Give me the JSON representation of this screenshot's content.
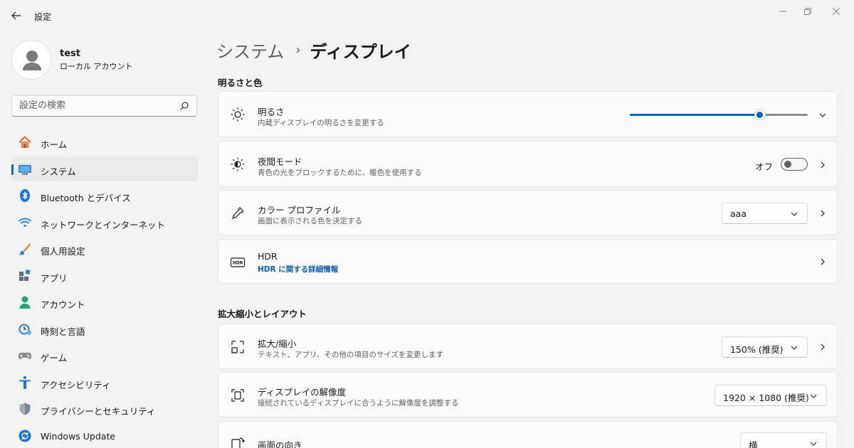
{
  "window": {
    "title": "設定"
  },
  "profile": {
    "name": "test",
    "type": "ローカル アカウント"
  },
  "search": {
    "placeholder": "設定の検索"
  },
  "sidebar": {
    "items": [
      {
        "label": "ホーム",
        "icon": "home-icon"
      },
      {
        "label": "システム",
        "icon": "system-icon",
        "active": true
      },
      {
        "label": "Bluetooth とデバイス",
        "icon": "bluetooth-icon"
      },
      {
        "label": "ネットワークとインターネット",
        "icon": "wifi-icon"
      },
      {
        "label": "個人用設定",
        "icon": "brush-icon"
      },
      {
        "label": "アプリ",
        "icon": "apps-icon"
      },
      {
        "label": "アカウント",
        "icon": "account-icon"
      },
      {
        "label": "時刻と言語",
        "icon": "clock-globe-icon"
      },
      {
        "label": "ゲーム",
        "icon": "gamepad-icon"
      },
      {
        "label": "アクセシビリティ",
        "icon": "accessibility-icon"
      },
      {
        "label": "プライバシーとセキュリティ",
        "icon": "shield-icon"
      },
      {
        "label": "Windows Update",
        "icon": "update-icon"
      }
    ]
  },
  "breadcrumb": {
    "parent": "システム",
    "separator": "›",
    "current": "ディスプレイ"
  },
  "sections": {
    "brightness_color": {
      "title": "明るさと色",
      "brightness": {
        "title": "明るさ",
        "desc": "内蔵ディスプレイの明るさを変更する",
        "value": 0.73
      },
      "night_light": {
        "title": "夜間モード",
        "desc": "青色の光をブロックするために、暖色を使用する",
        "state": "オフ"
      },
      "color_profile": {
        "title": "カラー プロファイル",
        "desc": "画面に表示される色を決定する",
        "value": "aaa"
      },
      "hdr": {
        "title": "HDR",
        "link": "HDR に関する詳細情報"
      }
    },
    "scale_layout": {
      "title": "拡大縮小とレイアウト",
      "scale": {
        "title": "拡大/縮小",
        "desc": "テキスト、アプリ、その他の項目のサイズを変更します",
        "value": "150% (推奨)"
      },
      "resolution": {
        "title": "ディスプレイの解像度",
        "desc": "接続されているディスプレイに合うように解像度を調整する",
        "value": "1920 × 1080 (推奨)"
      },
      "orientation": {
        "title": "画面の向き",
        "value": "横"
      }
    }
  },
  "colors": {
    "accent": "#0067c0",
    "link": "#0b5cad",
    "background": "#f3f3f3",
    "card": "#fbfbfb"
  }
}
